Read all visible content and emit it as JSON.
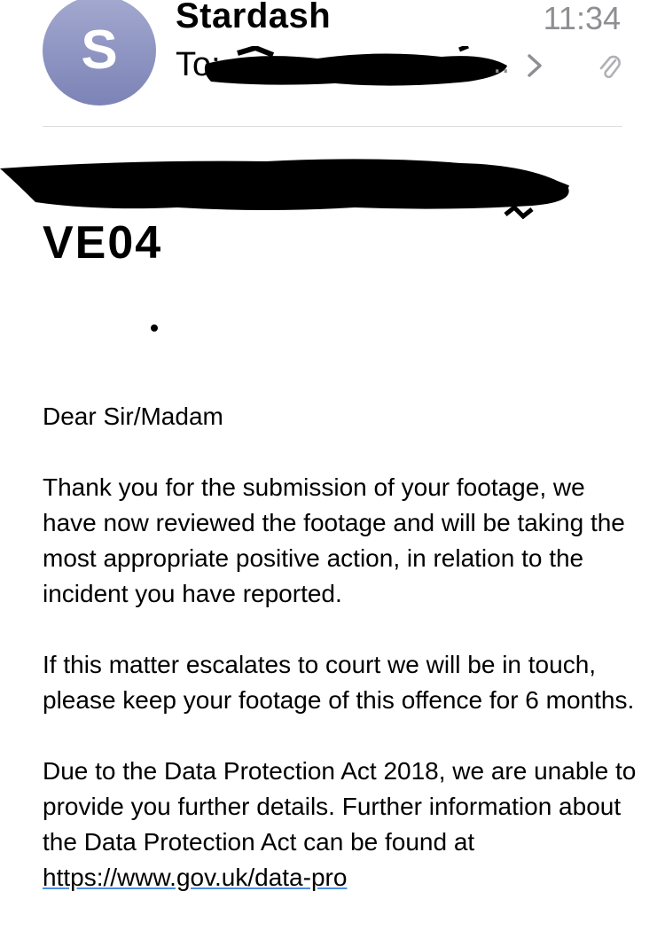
{
  "header": {
    "avatar_initial": "S",
    "sender": "Stardash",
    "time": "11:34",
    "to_label": "To:",
    "to_truncation": "..",
    "icons": [
      "chevron-right-icon",
      "paperclip-icon"
    ]
  },
  "subject": {
    "code": "VE04"
  },
  "body": {
    "greeting": "Dear Sir/Madam",
    "paragraph_1": "Thank you for the submission of your footage, we have now reviewed the footage and will be taking the most appropriate positive action, in relation to the incident you have reported.",
    "paragraph_2": "If this matter escalates to court we will be in touch, please keep your footage of this offence for 6 months.",
    "paragraph_3_text": "Due to the Data Protection Act 2018, we are unable to provide you further details. Further information about the Data Protection Act can be found at ",
    "link_text": "https://www.gov.uk/data-pro"
  },
  "colors": {
    "avatar": "#8f96c4",
    "secondary_text": "#8e8e93",
    "link_underline": "#4a90e2"
  }
}
